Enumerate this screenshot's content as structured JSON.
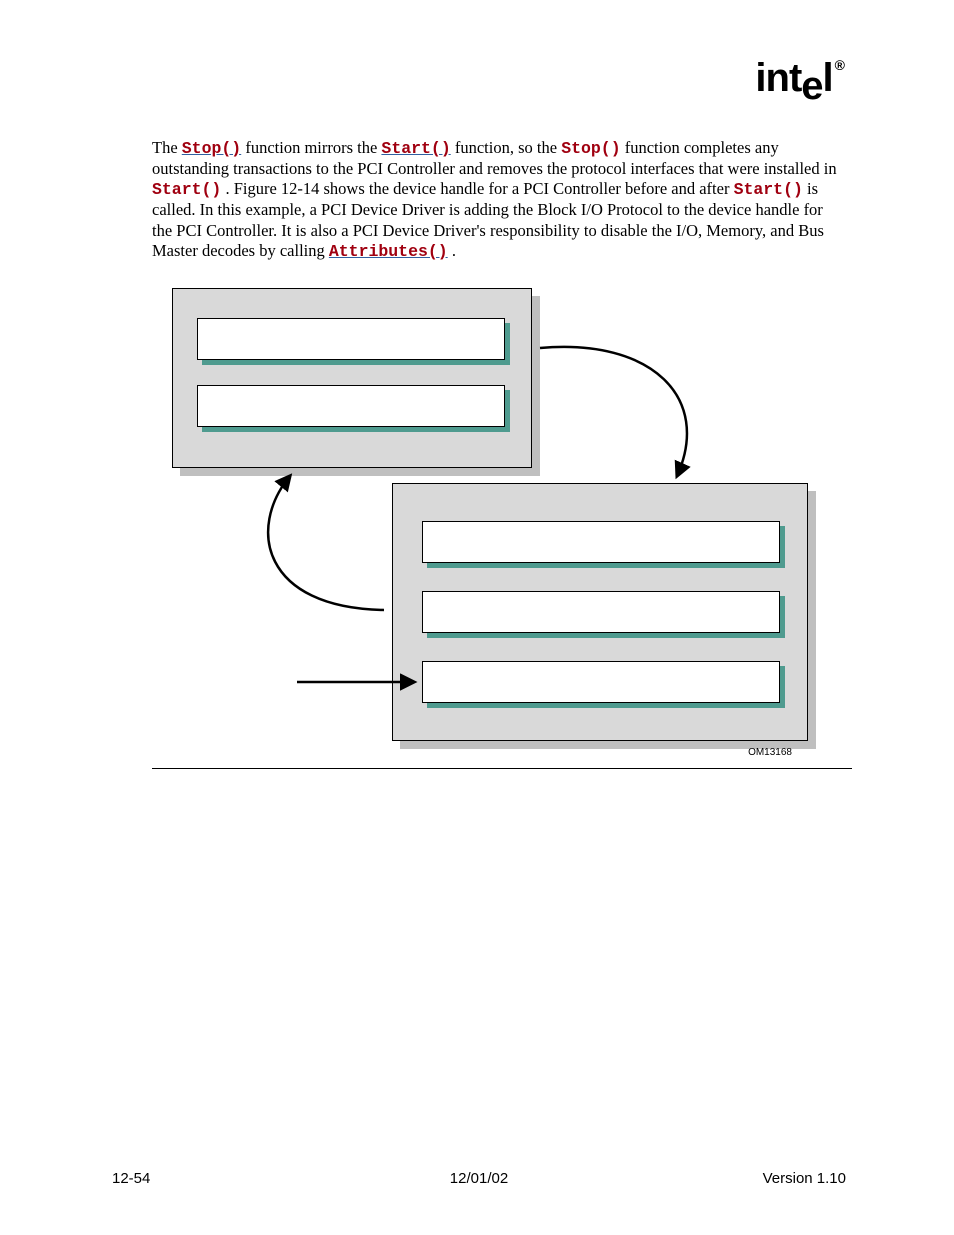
{
  "logo": {
    "prefix": "int",
    "e": "e",
    "suffix": "l",
    "dot": "®"
  },
  "para": {
    "t1": "The ",
    "stop": "Stop()",
    "t2": " function mirrors the ",
    "start": "Start()",
    "t3": " function, so the ",
    "stop2": "Stop()",
    "t4": " function completes any outstanding transactions to the PCI Controller and removes the protocol interfaces that were installed in ",
    "start2": "Start()",
    "t5": ".  Figure 12-14 shows the device handle for a PCI Controller before and after ",
    "start3": "Start()",
    "t6": " is called.  In this example, a PCI Device Driver is adding the Block I/O Protocol to the device handle for the PCI Controller.  It is also a PCI Device Driver's responsibility to disable the I/O, Memory, and Bus Master decodes by calling ",
    "attr": "Attributes()",
    "t7": "."
  },
  "figure": {
    "om": "OM13168"
  },
  "footer": {
    "page": "12-54",
    "date": "12/01/02",
    "version": "Version 1.10"
  }
}
